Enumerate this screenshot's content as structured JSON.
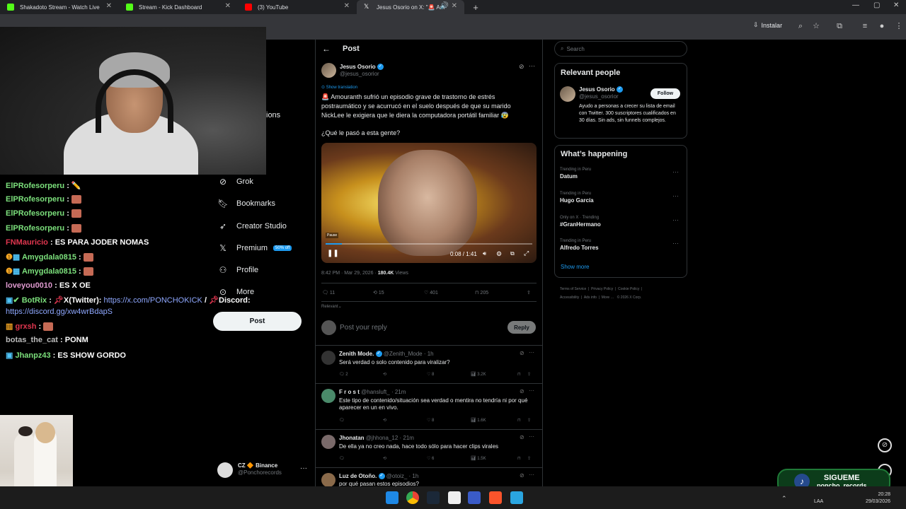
{
  "browser": {
    "tabs": [
      {
        "label": "Shakadoto Stream - Watch Live",
        "color": "#53fc18"
      },
      {
        "label": "Stream - Kick Dashboard",
        "color": "#53fc18"
      },
      {
        "label": "(3) YouTube",
        "color": "#ff0000"
      },
      {
        "label": "Jesus Osorio on X: \"🚨 Am",
        "color": "#ffffff"
      }
    ],
    "install_label": "Instalar"
  },
  "nav": {
    "partial_label": "ions",
    "items": [
      {
        "label": "Grok",
        "icon": "grok-icon"
      },
      {
        "label": "Bookmarks",
        "icon": "bookmark-icon"
      },
      {
        "label": "Creator Studio",
        "icon": "rocket-icon"
      },
      {
        "label": "Premium",
        "icon": "x-logo-icon",
        "badge": "50% off"
      },
      {
        "label": "Profile",
        "icon": "person-icon"
      },
      {
        "label": "More",
        "icon": "more-circle-icon"
      }
    ],
    "post_button": "Post",
    "account": {
      "name": "CZ 🔶 Binance",
      "handle": "@Ponchorecords"
    }
  },
  "post": {
    "header_title": "Post",
    "author": "Jesus Osorio",
    "handle": "@jesus_osorior",
    "show_translation": "Show translation",
    "text": "🚨 Amouranth sufrió un episodio grave de trastorno de estrés postraumático y se acurrucó en el suelo después de que su marido NickLee le exigiera que le diera la computadora portátil familiar 😰",
    "question": "¿Qué le pasó a esta gente?",
    "video": {
      "watermark": "Pause",
      "time": "0:08 / 1:41",
      "progress": 0.08
    },
    "meta_time": "8:42 PM · Mar 29, 2026 · ",
    "views_count": "180.4K",
    "views_label": " Views",
    "stats": {
      "replies": "11",
      "reposts": "15",
      "likes": "401",
      "bookmarks": "205"
    },
    "relevant_label": "Relevant",
    "reply_placeholder": "Post your reply",
    "reply_button": "Reply"
  },
  "replies": [
    {
      "name": "Zenith Mode.",
      "handle": "@Zenith_Mode · 1h",
      "text": "Será verdad o solo contenido para viralizar?",
      "replies": "2",
      "likes": "8",
      "views": "3.2K"
    },
    {
      "name": "F r o s t",
      "handle": "@hansluft_ · 21m",
      "text": "Este tipo de contenido/situación sea verdad o mentira no tendría ni por qué aparecer en un en vivo.",
      "replies": "",
      "likes": "8",
      "views": "1.6K"
    },
    {
      "name": "Jhonatan",
      "handle": "@jhhona_12 · 21m",
      "text": "De ella ya no creo nada, hace todo sólo para hacer clips virales",
      "replies": "",
      "likes": "6",
      "views": "1.5K"
    },
    {
      "name": "Luz de Otoño.",
      "handle": "@otoiz_ · 1h",
      "text": "por qué pasan estos episodios?",
      "replies": "",
      "likes": "",
      "views": ""
    }
  ],
  "sidebar": {
    "search_placeholder": "Search",
    "relevant_people": {
      "title": "Relevant people",
      "name": "Jesus Osorio",
      "handle": "@jesus_osorior",
      "follow": "Follow",
      "bio": "Ayudo a personas a crecer su lista de email con Twitter. 300 suscriptores cualificados en 30 días. Sin ads, sin funnels complejos."
    },
    "whats_happening": {
      "title": "What’s happening",
      "trends": [
        {
          "context": "Trending in Peru",
          "title": "Datum"
        },
        {
          "context": "Trending in Peru",
          "title": "Hugo García"
        },
        {
          "context": "Only on X · Trending",
          "title": "#GranHermano"
        },
        {
          "context": "Trending in Peru",
          "title": "Alfredo Torres"
        }
      ],
      "show_more": "Show more"
    },
    "footer": [
      "Terms of Service",
      "Privacy Policy",
      "Cookie Policy",
      "Accessibility",
      "Ads info",
      "More …",
      "© 2026 X Corp."
    ]
  },
  "chat": [
    {
      "user": "ElPRofesorperu",
      "msg": "",
      "color": "#7ce07c",
      "emote": "pencil"
    },
    {
      "user": "ElPRofesorperu",
      "msg": "",
      "color": "#7ce07c",
      "emote": "face"
    },
    {
      "user": "ElPRofesorperu",
      "msg": "",
      "color": "#7ce07c",
      "emote": "face"
    },
    {
      "user": "ElPRofesorperu",
      "msg": "",
      "color": "#7ce07c",
      "emote": "face"
    },
    {
      "user": "FNMauricio",
      "msg": "ES PARA JODER NOMAS",
      "color": "#e0364f"
    },
    {
      "user": "Amygdala0815",
      "msg": "",
      "color": "#7ce07c",
      "emote": "face"
    },
    {
      "user": "Amygdala0815",
      "msg": "",
      "color": "#7ce07c",
      "emote": "face"
    },
    {
      "user": "loveyou0010",
      "msg": "ES X OE",
      "color": "#e09ad0"
    },
    {
      "user": "BotRix",
      "msg_white": "X(Twitter): ",
      "link": "https://x.com/PONCHOKICK",
      "msg_white2": " / ",
      "msg_white3": "Discord:",
      "link2": "https://discord.gg/xw4wrBdapS",
      "color": "#7ce07c"
    },
    {
      "user": "grxsh",
      "msg": "",
      "color": "#e0364f",
      "emote": "face"
    },
    {
      "user": "botas_the_cat",
      "msg": "PONM",
      "color": "#bdbdbd"
    },
    {
      "user": "Jhanpz43",
      "msg": "ES SHOW GORDO",
      "color": "#7ce07c"
    }
  ],
  "overlay": {
    "follow_title": "SIGUEME",
    "follow_handle": "poncho_records"
  },
  "system": {
    "lang": "LAA",
    "time": "20:28",
    "date": "29/03/2026"
  }
}
